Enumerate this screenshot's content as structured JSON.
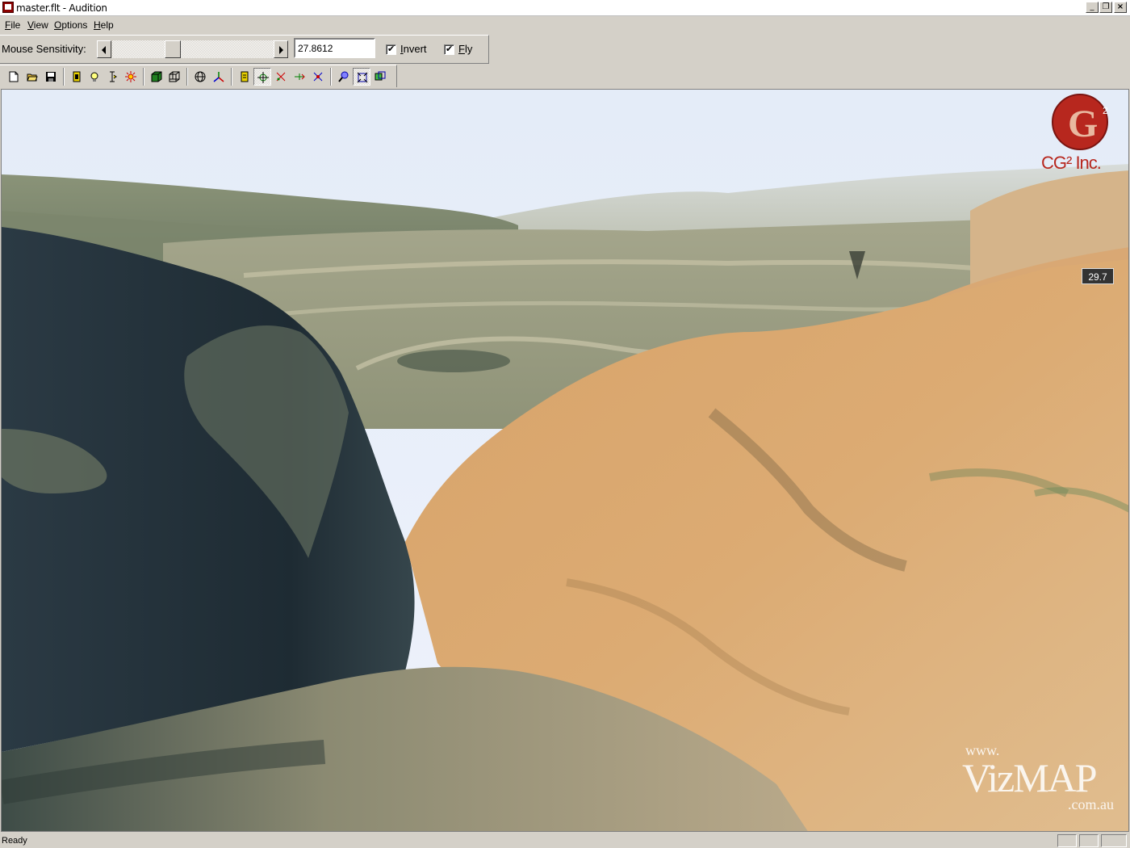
{
  "window": {
    "title": "master.flt - Audition",
    "minimize_glyph": "_",
    "restore_glyph": "❐",
    "close_glyph": "×"
  },
  "menu": {
    "file": {
      "accel": "F",
      "rest": "ile"
    },
    "view": {
      "accel": "V",
      "rest": "iew"
    },
    "options": {
      "accel": "O",
      "rest": "ptions"
    },
    "help": {
      "accel": "H",
      "rest": "elp"
    }
  },
  "settings": {
    "sensitivity_label": "Mouse Sensitivity:",
    "sensitivity_value": "27.8612",
    "slider_fraction": 0.36,
    "invert": {
      "accel": "I",
      "rest": "nvert",
      "checked": true
    },
    "fly": {
      "accel": "F",
      "rest": "ly",
      "checked": true
    }
  },
  "toolbar": {
    "buttons": [
      "new-file-icon",
      "open-folder-icon",
      "save-icon",
      "light-icon",
      "bulb-icon",
      "text-cursor-icon",
      "sun-icon",
      "solid-cube-icon",
      "wire-cube-icon",
      "globe-icon",
      "axes-icon",
      "lock-icon",
      "crosshair-icon",
      "scatter-icon",
      "pan-icon",
      "orbit-icon",
      "zoom-icon",
      "fit-icon",
      "frame-icon"
    ]
  },
  "viewport": {
    "fps_readout": "29.7",
    "logo_text": "CG² Inc.",
    "watermark": {
      "prefix": "www.",
      "brand": "VizMAP",
      "suffix": ".com.au"
    }
  },
  "status": {
    "text": "Ready"
  },
  "colors": {
    "chrome": "#d4d0c8",
    "sky": "#e9effa",
    "logo": "#b7271e"
  }
}
